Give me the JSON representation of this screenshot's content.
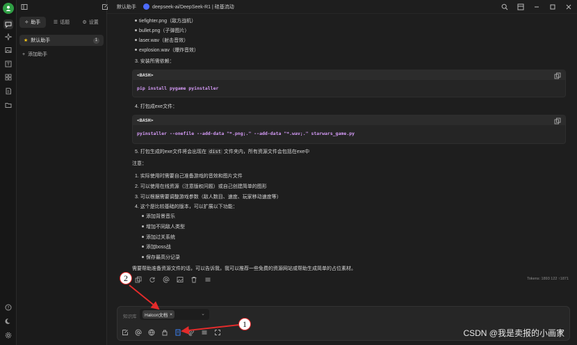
{
  "rail": {
    "avatar_letter": "",
    "items": [
      "chat-icon",
      "sparkle-icon",
      "image-icon",
      "translate-icon",
      "apps-icon",
      "files-icon",
      "folder-icon"
    ],
    "bottom": [
      "help-icon",
      "moon-icon",
      "settings-icon"
    ]
  },
  "sidebar": {
    "tabs": [
      {
        "label": "助手",
        "icon": "sparkle-icon"
      },
      {
        "label": "话题",
        "icon": "list-icon"
      },
      {
        "label": "设置",
        "icon": "gear-icon"
      }
    ],
    "assistant": {
      "label": "默认助手",
      "badge": "1"
    },
    "add_assistant": "添加助手"
  },
  "header": {
    "assistant_name": "默认助手",
    "model": "deepseek-ai/DeepSeek-R1 | 硅基流动"
  },
  "content": {
    "bullets_top": [
      "tiefighter.png（敌方战机）",
      "bullet.png（子弹图片）",
      "laser.wav（射击音效）",
      "explosion.wav（爆炸音效）"
    ],
    "step3": "3. 安装所需依赖：",
    "code1": {
      "lang": "<BASH>",
      "code": "pip install pygame pyinstaller"
    },
    "step4": "4. 打包成exe文件：",
    "code2": {
      "lang": "<BASH>",
      "code": "pyinstaller --onefile --add-data \"*.png;.\" --add-data \"*.wav;.\" starwars_game.py"
    },
    "step5_pre": "5. 打包生成的exe文件将会出现在",
    "step5_code": "dist",
    "step5_post": "文件夹内，所有资源文件会包括在exe中",
    "note_title": "注意：",
    "notes": [
      "1. 实际使用时需要自己准备游戏的音效和图片文件",
      "2. 可以使用在线资源（注意版权问题）或自己创建简单的图形",
      "3. 可以根据需要调整游戏参数（敌人数目、速度、玩家移动速度等）",
      "4. 这个是比较基础的版本，可以扩展以下功能："
    ],
    "sub_bullets": [
      "添加背景音乐",
      "增加不同敌人类型",
      "添加过关系统",
      "添加boss战",
      "保存最高分记录"
    ],
    "closing": "需要帮助准备资源文件的话，可以告诉我，我可以推荐一些免费的资源网站或帮助生成简单的占位素材。",
    "tokens": "Tokens: 1893 122 ↑1871"
  },
  "input": {
    "kb_label": "知识库",
    "kb_value": "Halcon文档",
    "tools": [
      "new-topic-icon",
      "mention-icon",
      "web-search-icon",
      "paint-icon",
      "knowledge-base-icon",
      "attachment-icon",
      "shortcut-icon",
      "expand-icon"
    ]
  },
  "annotations": {
    "one": "1",
    "two": "2",
    "color": "#e32b2b"
  },
  "watermark": "CSDN @我是卖报的小画家"
}
